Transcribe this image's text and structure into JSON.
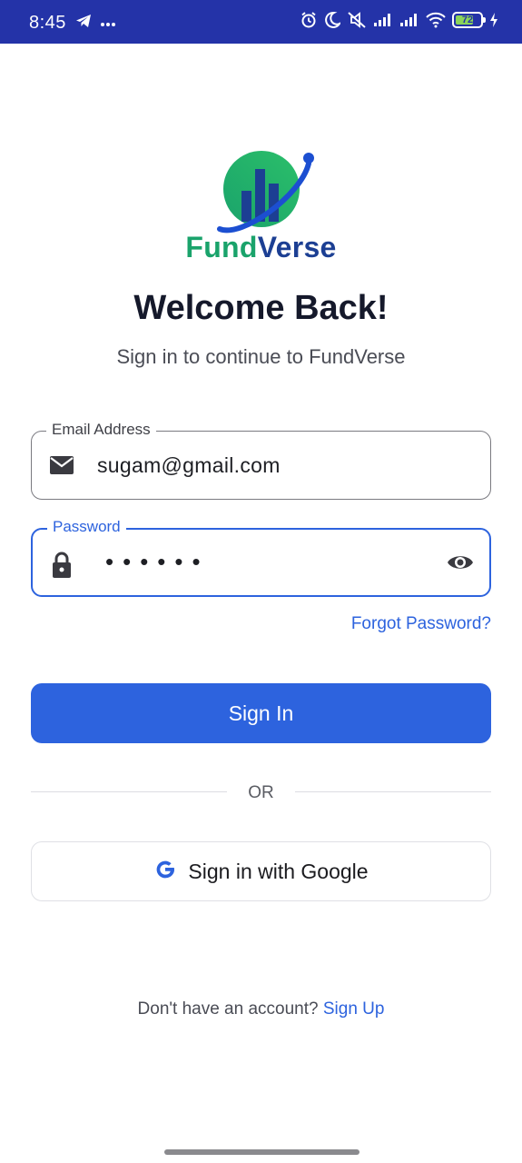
{
  "status_bar": {
    "time": "8:45",
    "battery_level": "72",
    "battery_fraction": 0.72,
    "icons": [
      "telegram-icon",
      "more-dots-icon",
      "alarm-icon",
      "moon-icon",
      "mute-icon",
      "signal-icon",
      "signal-icon",
      "wifi-icon",
      "battery-icon",
      "charging-icon"
    ]
  },
  "brand": {
    "name_part_1": "Fund",
    "name_part_2": "Verse",
    "color_green": "#1aa36b",
    "color_navy": "#1c3f93"
  },
  "header": {
    "title": "Welcome Back!",
    "subtitle": "Sign in to continue to FundVerse"
  },
  "form": {
    "email": {
      "label": "Email Address",
      "value": "sugam@gmail.com",
      "icon": "mail-icon"
    },
    "password": {
      "label": "Password",
      "masked_value": "••••••",
      "icon": "lock-icon",
      "toggle_icon": "eye-icon"
    },
    "forgot_password": "Forgot Password?",
    "sign_in_button": "Sign In",
    "divider_text": "OR",
    "google_button": "Sign in with Google"
  },
  "footer": {
    "prompt": "Don't have an account?",
    "sign_up_link": "Sign Up"
  },
  "colors": {
    "accent": "#2d63de",
    "status_bar": "#2433a8"
  }
}
